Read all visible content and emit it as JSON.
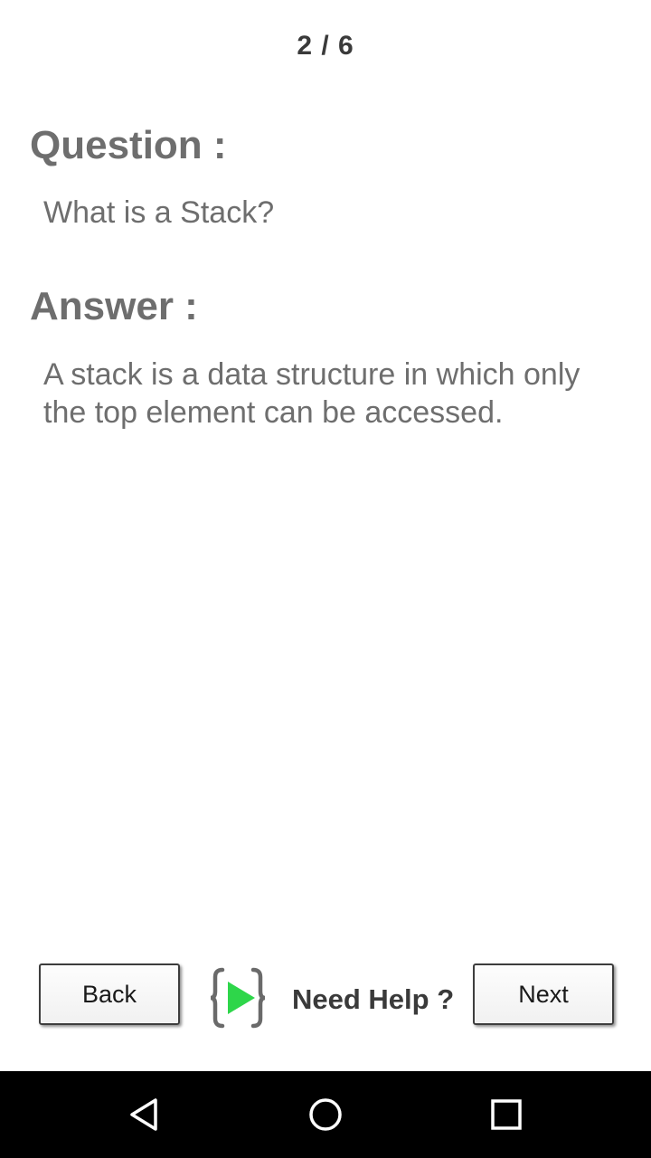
{
  "header": {
    "counter": "2 / 6"
  },
  "question": {
    "label": "Question :",
    "text": "What is a Stack?"
  },
  "answer": {
    "label": "Answer :",
    "text": "A stack is a data structure in which only the top element can be accessed."
  },
  "footer": {
    "back_label": "Back",
    "help_label": "Need Help ?",
    "next_label": "Next",
    "help_icon": "bracket-play-logo-icon",
    "accent": "#2ed64a"
  },
  "navbar": {
    "icons": [
      "back-triangle-icon",
      "home-circle-icon",
      "recents-square-icon"
    ]
  }
}
